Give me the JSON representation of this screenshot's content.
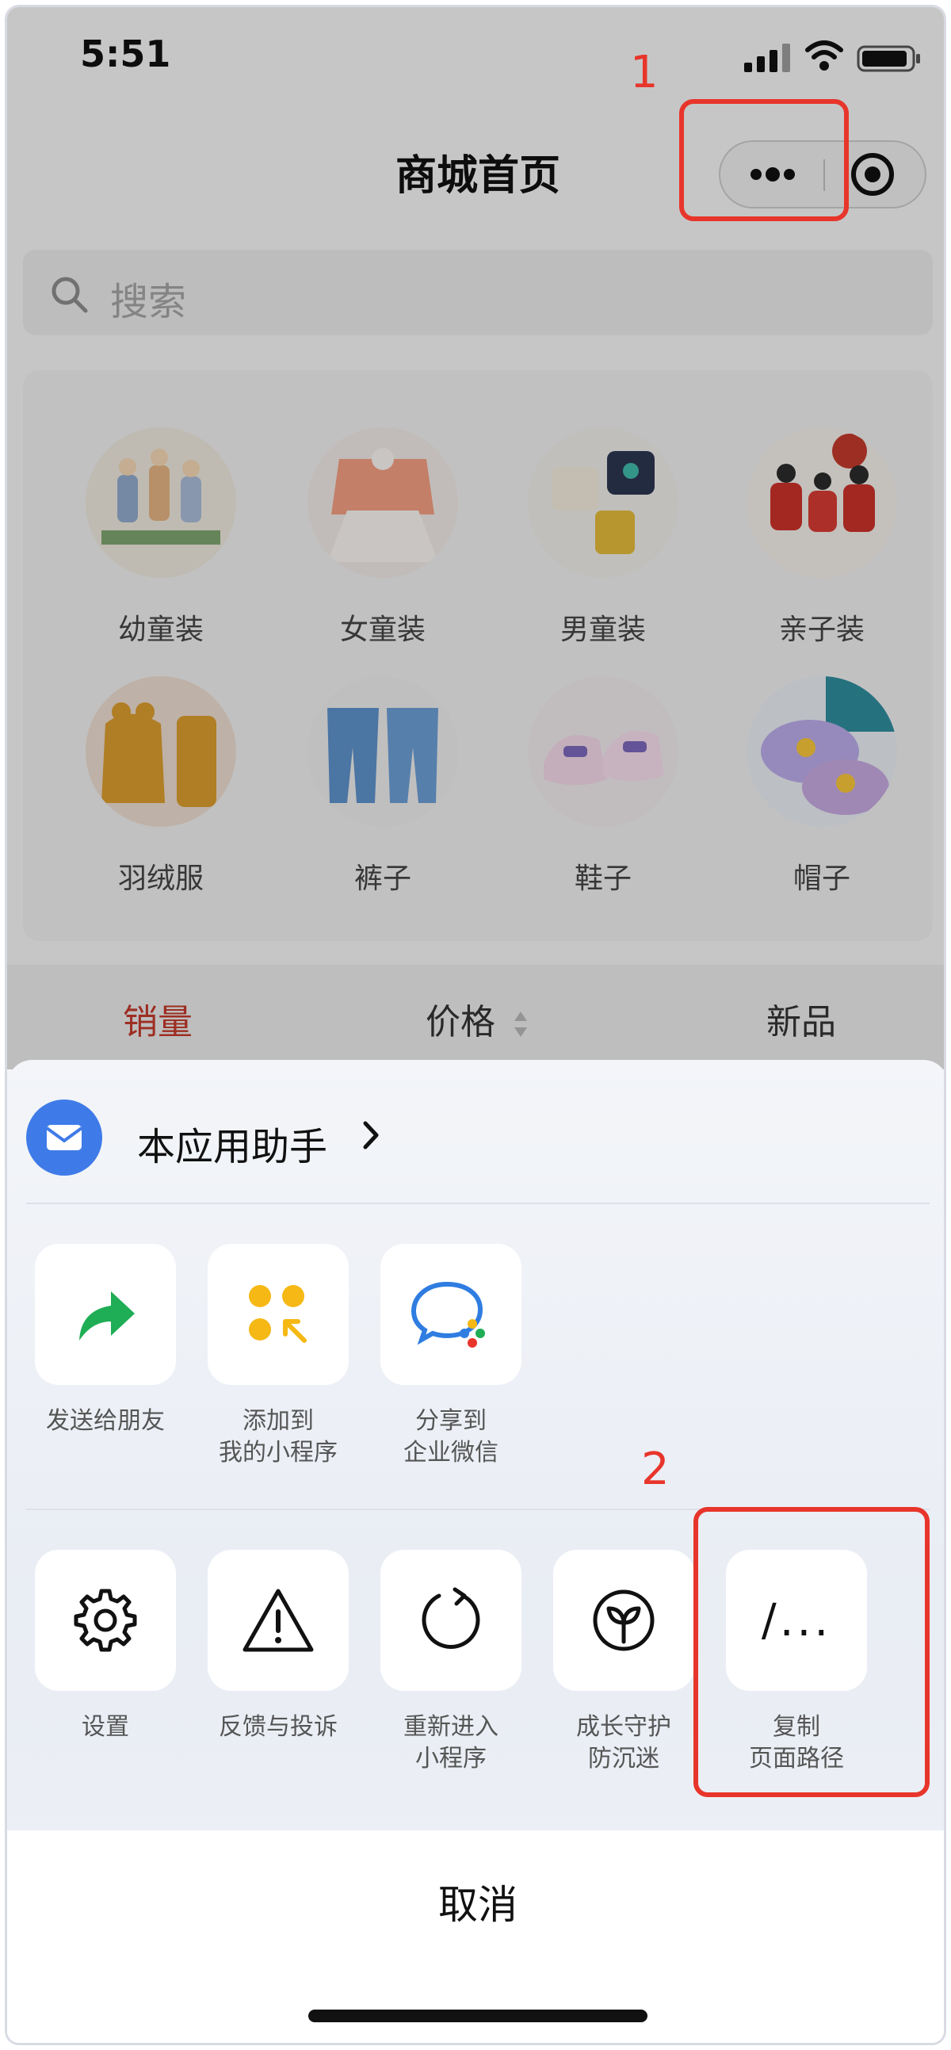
{
  "status_bar": {
    "time": "5:51"
  },
  "nav": {
    "title": "商城首页"
  },
  "search": {
    "placeholder": "搜索"
  },
  "categories": [
    {
      "label": "幼童装"
    },
    {
      "label": "女童装"
    },
    {
      "label": "男童装"
    },
    {
      "label": "亲子装"
    },
    {
      "label": "羽绒服"
    },
    {
      "label": "裤子"
    },
    {
      "label": "鞋子"
    },
    {
      "label": "帽子"
    }
  ],
  "sort_tabs": [
    {
      "label": "销量",
      "active": true
    },
    {
      "label": "价格",
      "active": false
    },
    {
      "label": "新品",
      "active": false
    }
  ],
  "action_sheet": {
    "assistant_label": "本应用助手",
    "row1": [
      {
        "label": "发送给朋友",
        "icon": "share-arrow-icon"
      },
      {
        "label": "添加到\n我的小程序",
        "icon": "add-mini-program-icon"
      },
      {
        "label": "分享到\n企业微信",
        "icon": "wecom-icon"
      }
    ],
    "row2": [
      {
        "label": "设置",
        "icon": "gear-icon"
      },
      {
        "label": "反馈与投诉",
        "icon": "warning-icon"
      },
      {
        "label": "重新进入\n小程序",
        "icon": "reload-icon"
      },
      {
        "label": "成长守护\n防沉迷",
        "icon": "sprout-icon"
      },
      {
        "label": "复制\n页面路径",
        "icon": "copy-path-icon",
        "glyph": "/..."
      }
    ],
    "cancel_label": "取消"
  },
  "annotations": [
    {
      "number": "1"
    },
    {
      "number": "2"
    }
  ],
  "colors": {
    "annotation": "#e8352b",
    "active_tab": "#c0392b",
    "assistant_avatar": "#3f7be8",
    "share_green": "#1fad55",
    "mini_program_yellow": "#f5b814"
  }
}
